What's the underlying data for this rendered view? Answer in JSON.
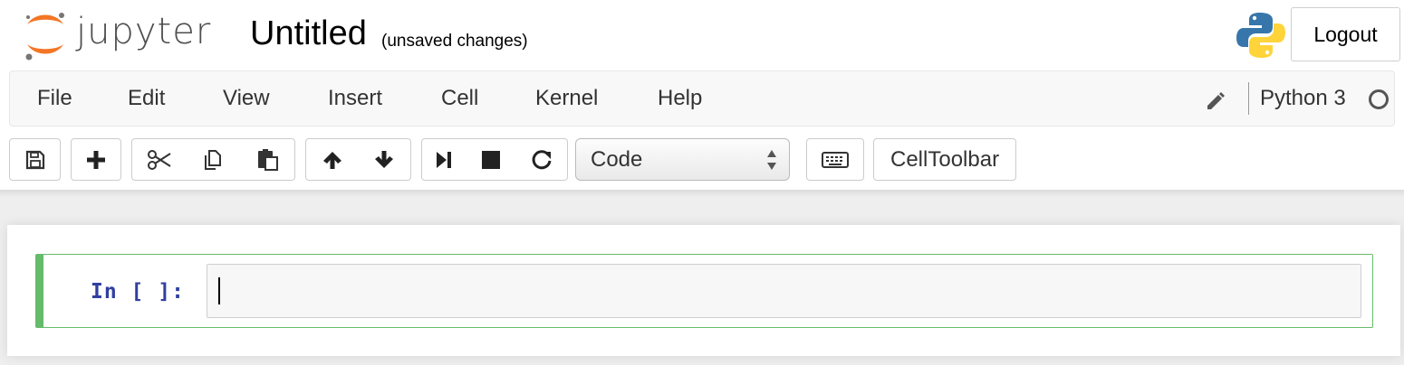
{
  "header": {
    "logo_text": "jupyter",
    "notebook_name": "Untitled",
    "save_status": "(unsaved changes)",
    "logout_label": "Logout"
  },
  "menubar": {
    "items": [
      "File",
      "Edit",
      "View",
      "Insert",
      "Cell",
      "Kernel",
      "Help"
    ],
    "kernel_name": "Python 3"
  },
  "toolbar": {
    "icons": [
      "save-icon",
      "plus-icon",
      "scissors-icon",
      "copy-icon",
      "paste-icon",
      "arrow-up-icon",
      "arrow-down-icon",
      "run-step-icon",
      "stop-icon",
      "restart-icon",
      "keyboard-icon"
    ],
    "cell_type_selected": "Code",
    "celltoolbar_label": "CellToolbar"
  },
  "cell": {
    "prompt": "In [ ]:",
    "input_value": ""
  },
  "colors": {
    "logo_orange": "#f37626",
    "prompt_blue": "#303f9f",
    "cell_selected_border": "#66bb6a",
    "python_blue": "#3776ab",
    "python_yellow": "#ffd43b"
  }
}
